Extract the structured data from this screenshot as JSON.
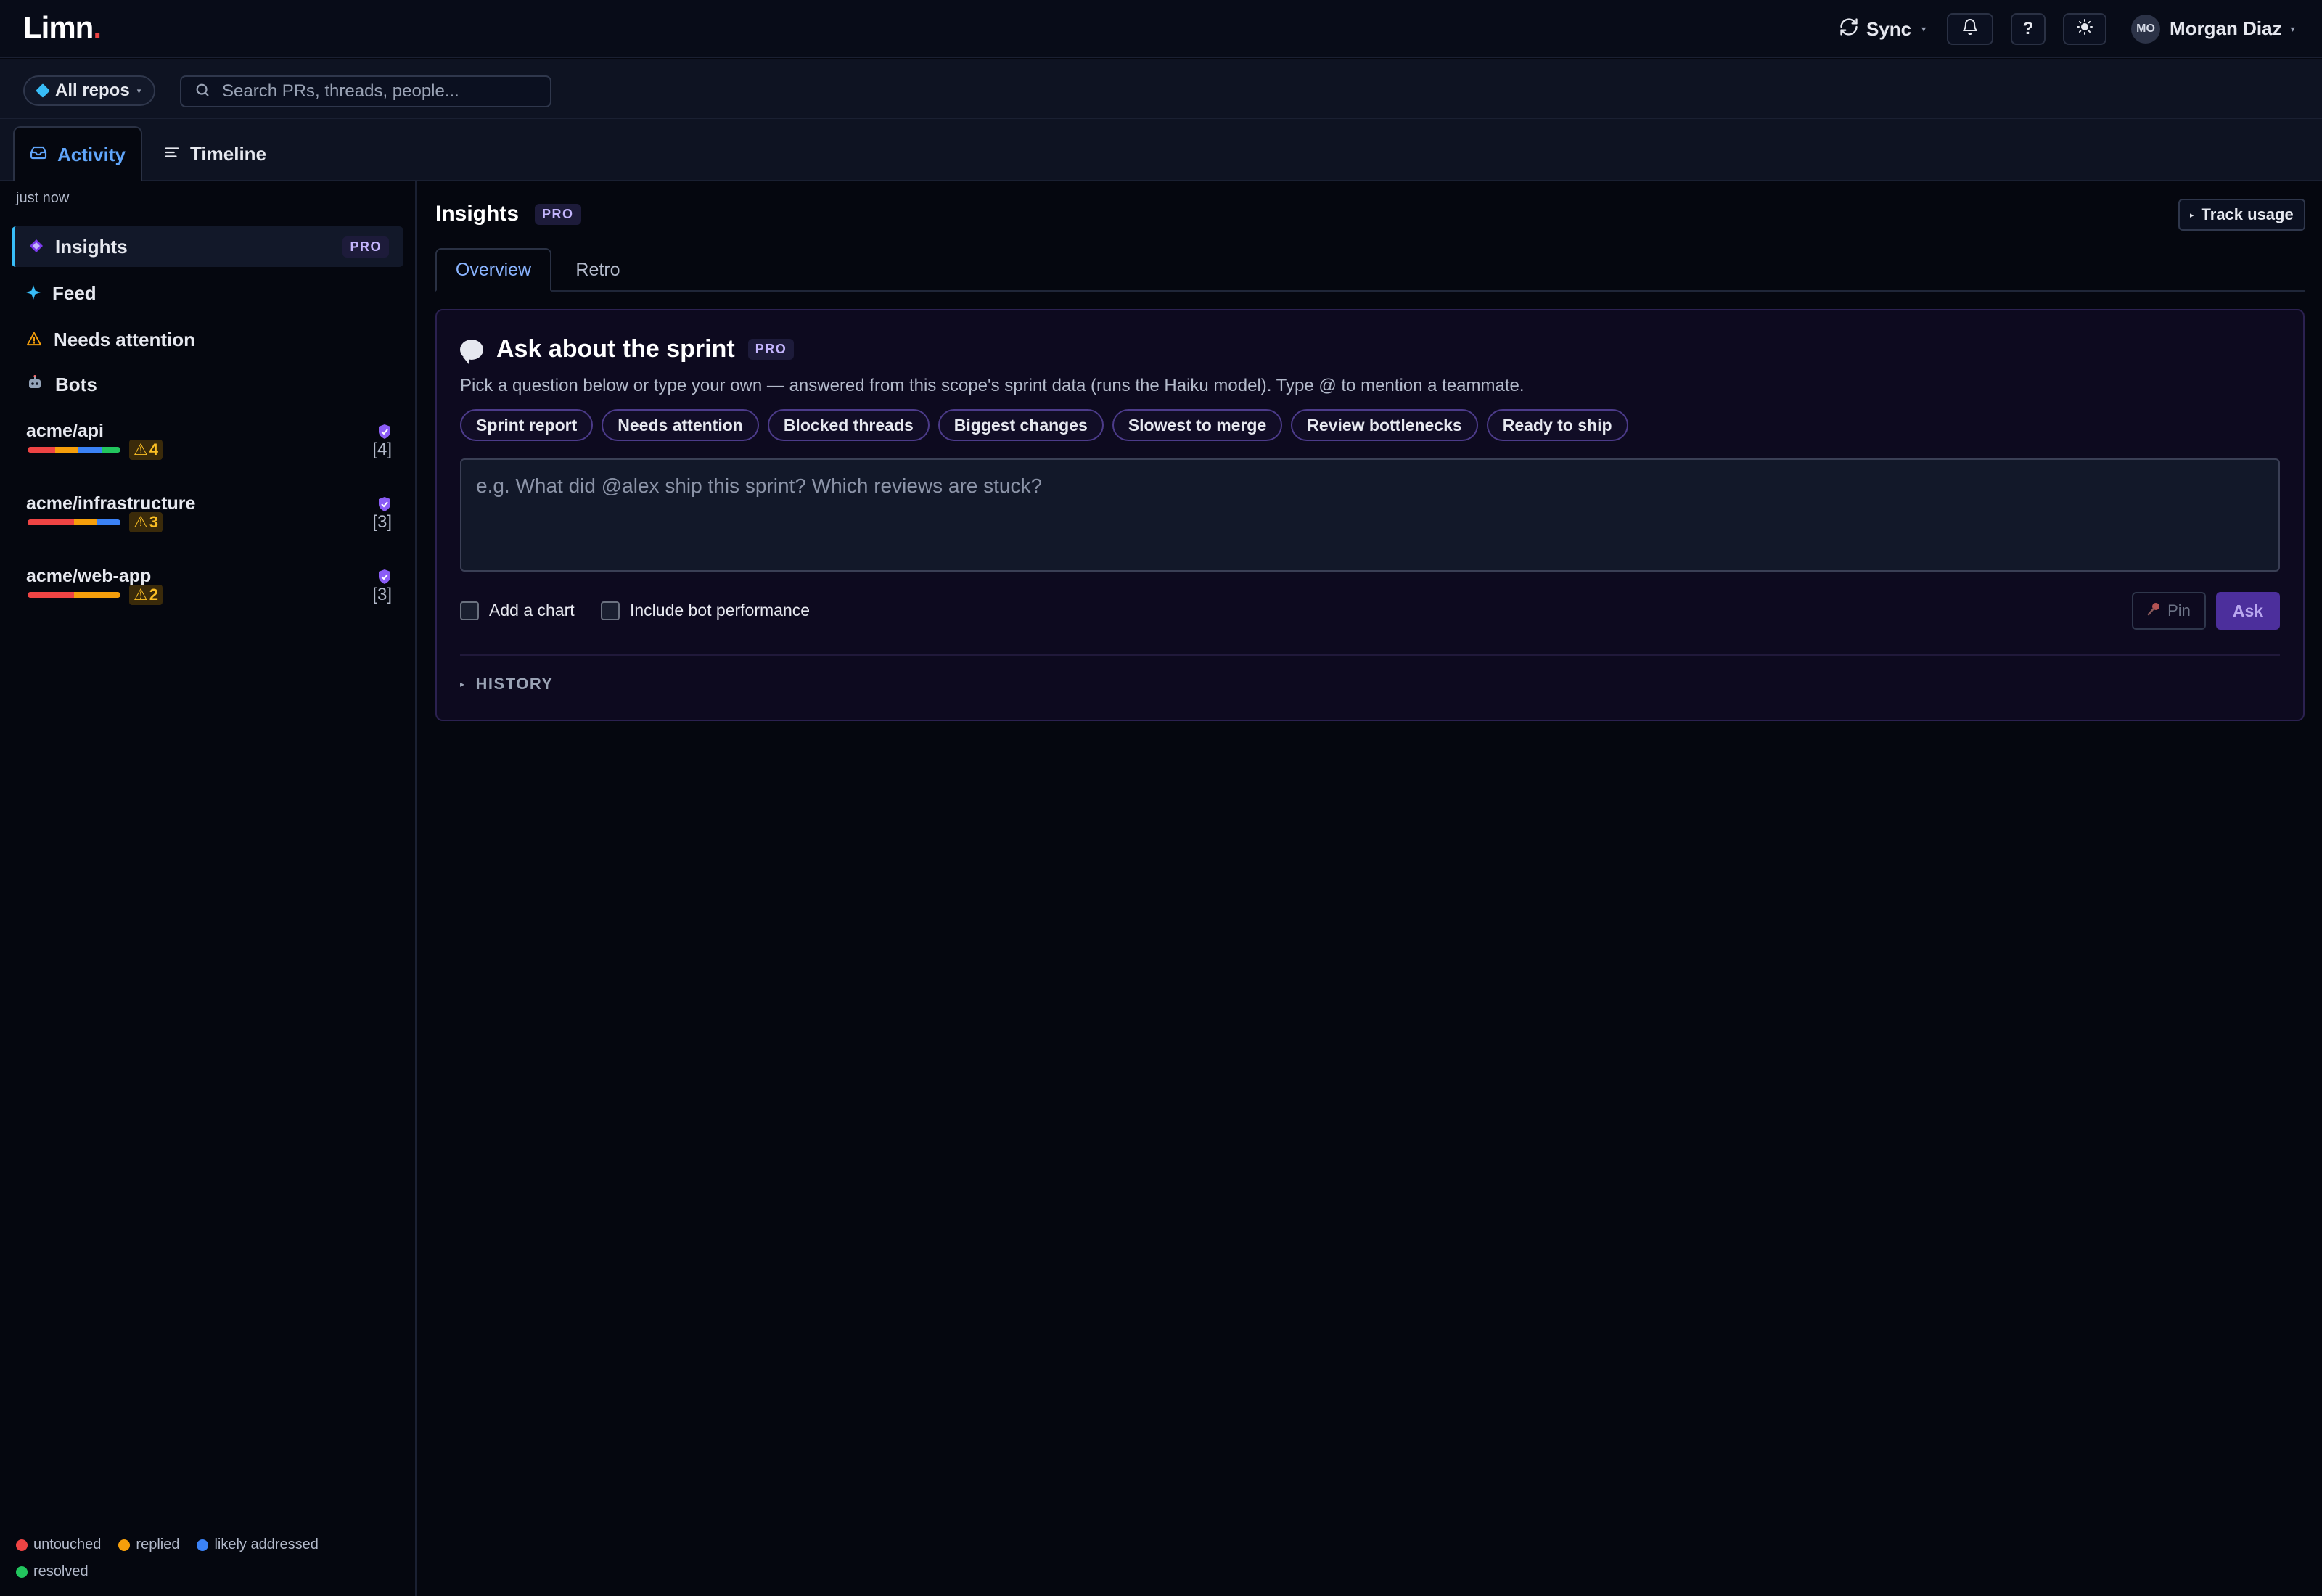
{
  "app": {
    "logo": "Limn",
    "logo_dot": ".",
    "sync_label": "Sync",
    "help_label": "?",
    "user": {
      "initials": "MO",
      "name": "Morgan Diaz"
    }
  },
  "filters": {
    "repo_scope": "All repos",
    "search_placeholder": "Search PRs, threads, people..."
  },
  "tabs": [
    {
      "label": "Activity",
      "active": true
    },
    {
      "label": "Timeline",
      "active": false
    }
  ],
  "sidebar": {
    "last_sync": "just now",
    "nav": [
      {
        "label": "Insights",
        "badge": "PRO",
        "active": true
      },
      {
        "label": "Feed"
      },
      {
        "label": "Needs attention"
      },
      {
        "label": "Bots"
      }
    ],
    "repos": [
      {
        "name": "acme/api",
        "warnings": "4",
        "count": "[4]",
        "status_split": [
          0.3,
          0.25,
          0.25,
          0.2
        ]
      },
      {
        "name": "acme/infrastructure",
        "warnings": "3",
        "count": "[3]",
        "status_split": [
          0.5,
          0.25,
          0.25,
          0
        ]
      },
      {
        "name": "acme/web-app",
        "warnings": "2",
        "count": "[3]",
        "status_split": [
          0.5,
          0.5,
          0,
          0
        ]
      }
    ],
    "legend": [
      {
        "label": "untouched",
        "color": "#ef4444"
      },
      {
        "label": "replied",
        "color": "#f59e0b"
      },
      {
        "label": "likely addressed",
        "color": "#3b82f6"
      },
      {
        "label": "resolved",
        "color": "#22c55e"
      }
    ]
  },
  "main": {
    "title": "Insights",
    "title_badge": "PRO",
    "track_usage": "Track usage",
    "subtabs": [
      {
        "label": "Overview",
        "active": true
      },
      {
        "label": "Retro",
        "active": false
      }
    ],
    "ask": {
      "title": "Ask about the sprint",
      "badge": "PRO",
      "description": "Pick a question below or type your own — answered from this scope's sprint data (runs the Haiku model). Type @ to mention a teammate.",
      "chips": [
        "Sprint report",
        "Needs attention",
        "Blocked threads",
        "Biggest changes",
        "Slowest to merge",
        "Review bottlenecks",
        "Ready to ship"
      ],
      "input_placeholder": "e.g. What did @alex ship this sprint? Which reviews are stuck?",
      "options": [
        {
          "label": "Add a chart",
          "checked": false
        },
        {
          "label": "Include bot performance",
          "checked": false
        }
      ],
      "pin_label": "Pin",
      "ask_label": "Ask",
      "history_label": "HISTORY"
    }
  },
  "colors": {
    "accent_blue": "#60a5fa",
    "pro_purple": "#c4b5fd",
    "ask_button": "#4c2f9c",
    "warning": "#fbbf24"
  }
}
